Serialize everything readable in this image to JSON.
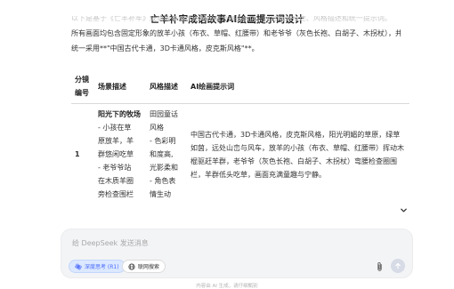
{
  "header": {
    "title": "亡羊补牢成语故事AI绘画提示词设计"
  },
  "intro": {
    "lines": [
      "以下是基于《亡羊补牢》成语故事设计的AI绘画分镜提示词，包含场景描述、风格描述和统一提示词。",
      "所有画面均包含固定形象的放羊小孩（布衣、草帽、红腰带）和老爷爷（灰色长袍、白胡子、木拐杖），并",
      "统一采用**\"中国古代卡通，3D卡通风格，皮克斯风格\"**。"
    ]
  },
  "table": {
    "headers": {
      "num": "分镜编号",
      "scene": "场景描述",
      "style": "风格描述",
      "prompt": "AI绘画提示词"
    },
    "rows": [
      {
        "num": "1",
        "scene_title": "阳光下的牧场",
        "scene_lines": [
          "- 小孩在草",
          "原放羊，羊",
          "群悠闲吃草",
          "- 老爷爷站",
          "在木质羊圈",
          "旁检查围栏"
        ],
        "style_lines": [
          "田园童话",
          "风格",
          "- 色彩明",
          "和度高,",
          "光影柔和",
          "- 角色表",
          "情生动"
        ],
        "prompt": "中国古代卡通，3D卡通风格，皮克斯风格，阳光明媚的草原，绿草如茵，远处山峦与风车，放羊的小孩（布衣、草帽、红腰带）挥动木棍驱赶羊群，老爷爷（灰色长袍、白胡子、木拐杖）弯腰检查圈围栏，羊群低头吃草，画面充满童趣与宁静。"
      }
    ]
  },
  "composer": {
    "placeholder": "给 DeepSeek 发送消息",
    "deep_think_label": "深度思考 (R1)",
    "web_search_label": "联网搜索"
  },
  "footer": {
    "note": "内容由 AI 生成，请仔细甄别"
  },
  "colors": {
    "accent": "#4d6bfe",
    "composer_bg": "#f3f4f6"
  }
}
